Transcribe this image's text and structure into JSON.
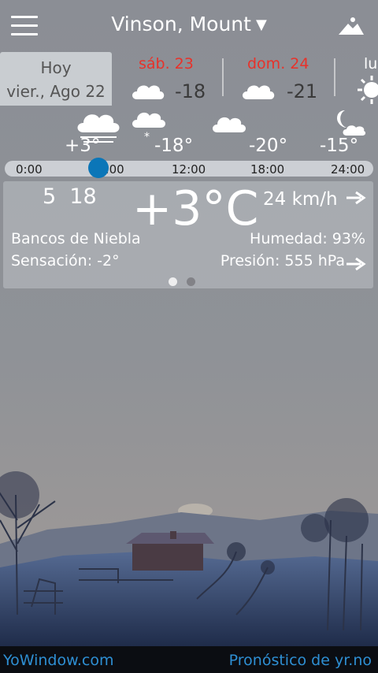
{
  "header": {
    "location": "Vinson, Mount",
    "location_caret": "▼"
  },
  "days": [
    {
      "name": "Hoy",
      "date": "vier., Ago 22"
    },
    {
      "label": "sáb. 23",
      "temp": "-18",
      "icon": "cloud-icon"
    },
    {
      "label": "dom. 24",
      "temp": "-21",
      "icon": "cloud-icon"
    },
    {
      "label": "lu",
      "icon": "sun-icon"
    }
  ],
  "hourly": {
    "temps": [
      "+3°",
      "-18°",
      "-20°",
      "-15°"
    ],
    "icons": [
      "fog-cloud-icon",
      "snow-cloud-icon",
      "cloud-icon",
      "moon-cloud-icon"
    ],
    "ticks": [
      "0:00",
      "6:00",
      "12:00",
      "18:00",
      "24:00"
    ]
  },
  "current": {
    "sunrise_hour": "5",
    "sunset_hour": "18",
    "temperature": "+3°C",
    "wind": "24 km/h",
    "condition": "Bancos de Niebla",
    "feels_like": "Sensación: -2°",
    "humidity": "Humedad: 93%",
    "pressure": "Presión: 555 hPa",
    "page_count": 2,
    "active_page": 1
  },
  "footer": {
    "left_link": "YoWindow.com",
    "right_link": "Pronóstico de yr.no"
  },
  "colors": {
    "accent_blue": "#0b76b8",
    "weekend_red": "#e8322a",
    "footer_link": "#2e8fd3",
    "sky": "#8d9096",
    "snow": "#3f5680"
  }
}
